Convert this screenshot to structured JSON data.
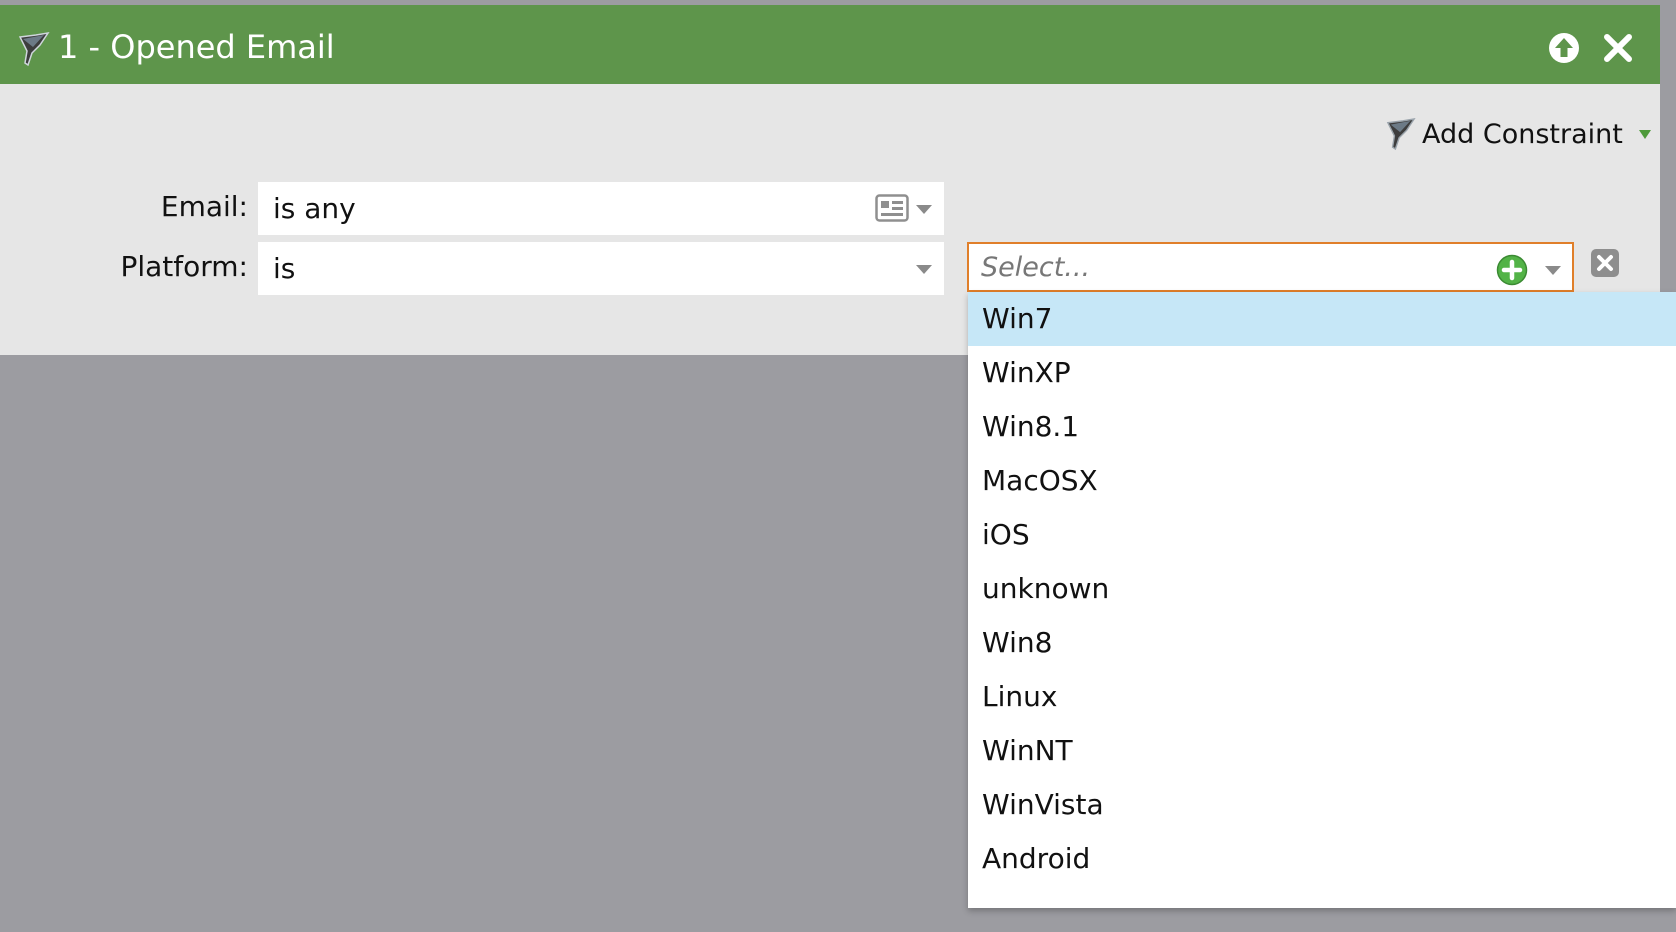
{
  "header": {
    "title": "1 - Opened Email",
    "bg_color": "#5e954b",
    "icons": [
      "funnel-icon",
      "move-up-icon",
      "close-icon"
    ]
  },
  "toolbar": {
    "add_constraint_label": "Add Constraint",
    "caret_color": "#4e9a3a"
  },
  "filters": [
    {
      "label": "Email:",
      "operator": "is any"
    },
    {
      "label": "Platform:",
      "operator": "is",
      "value_placeholder": "Select...",
      "accent_border": "#e07f2a"
    }
  ],
  "platform_dropdown": {
    "highlighted_index": 0,
    "highlight_color": "#c6e7f7",
    "options": [
      "Win7",
      "WinXP",
      "Win8.1",
      "MacOSX",
      "iOS",
      "unknown",
      "Win8",
      "Linux",
      "WinNT",
      "WinVista",
      "Android"
    ]
  }
}
